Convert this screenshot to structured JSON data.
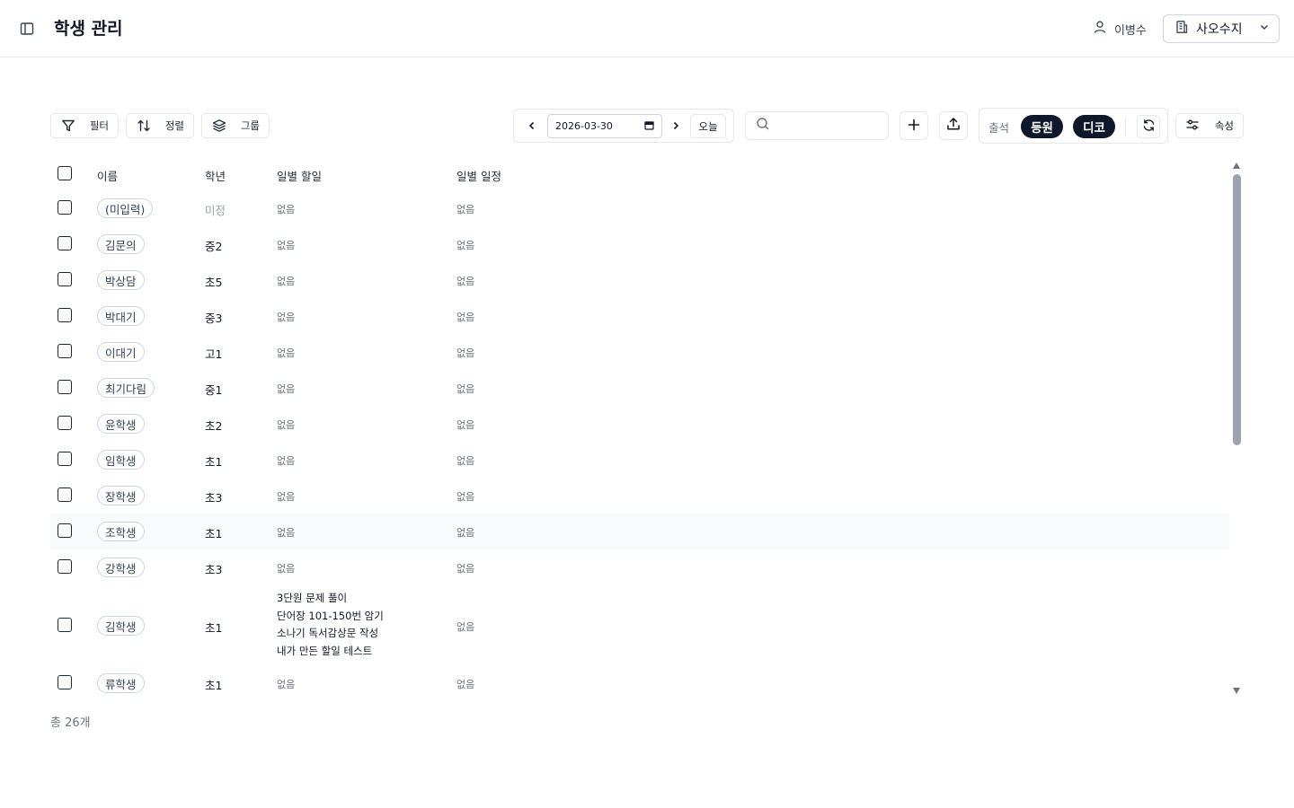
{
  "header": {
    "title": "학생 관리",
    "user_name": "이병수",
    "org_name": "사오수지"
  },
  "toolbar": {
    "filter_label": "필터",
    "sort_label": "정렬",
    "group_label": "그룹",
    "date_value": "2026-03-30",
    "today_label": "오늘",
    "search_value": "",
    "search_placeholder": "",
    "attendance_label": "출석",
    "checkin_label": "등원",
    "checkout_label": "디코",
    "properties_label": "속성"
  },
  "table": {
    "columns": [
      "이름",
      "학년",
      "일별 할일",
      "일별 일정"
    ],
    "rows": [
      {
        "name": "(미입력)",
        "grade": "미정",
        "todo": "없음",
        "schedule": "없음"
      },
      {
        "name": "김문의",
        "grade": "중2",
        "todo": "없음",
        "schedule": "없음"
      },
      {
        "name": "박상담",
        "grade": "초5",
        "todo": "없음",
        "schedule": "없음"
      },
      {
        "name": "박대기",
        "grade": "중3",
        "todo": "없음",
        "schedule": "없음"
      },
      {
        "name": "이대기",
        "grade": "고1",
        "todo": "없음",
        "schedule": "없음"
      },
      {
        "name": "최기다림",
        "grade": "중1",
        "todo": "없음",
        "schedule": "없음"
      },
      {
        "name": "윤학생",
        "grade": "초2",
        "todo": "없음",
        "schedule": "없음"
      },
      {
        "name": "임학생",
        "grade": "초1",
        "todo": "없음",
        "schedule": "없음"
      },
      {
        "name": "장학생",
        "grade": "초3",
        "todo": "없음",
        "schedule": "없음"
      },
      {
        "name": "조학생",
        "grade": "초1",
        "todo": "없음",
        "schedule": "없음"
      },
      {
        "name": "강학생",
        "grade": "초3",
        "todo": "없음",
        "schedule": "없음"
      },
      {
        "name": "김학생",
        "grade": "초1",
        "todo_items": [
          "3단원 문제 풀이",
          "단어장 101-150번 암기",
          "소나기 독서감상문 작성",
          "내가 만든 할일 테스트"
        ],
        "schedule": "없음"
      },
      {
        "name": "류학생",
        "grade": "초1",
        "todo": "없음",
        "schedule": "없음"
      }
    ]
  },
  "footer": {
    "total_label": "총 26개"
  },
  "colors": {
    "accent_dark": "#0f172a",
    "border": "#e5e7eb",
    "muted_text": "#6b7280"
  },
  "icons": {
    "sidebar": "sidebar-toggle-icon",
    "user": "user-icon",
    "org": "building-icon",
    "filter": "filter-icon",
    "sort": "sort-icon",
    "group": "layers-icon",
    "add": "plus-icon",
    "export": "upload-icon",
    "refresh": "refresh-icon",
    "properties": "sliders-icon"
  }
}
